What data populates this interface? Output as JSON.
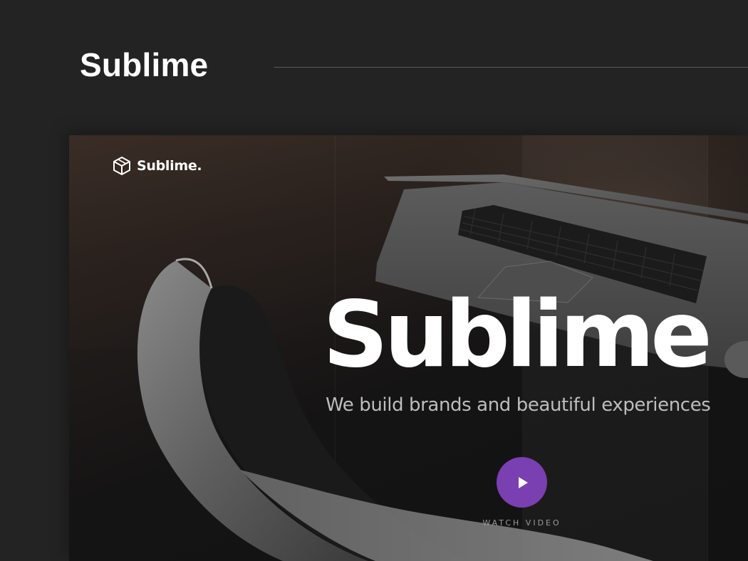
{
  "header": {
    "title": "Sublime"
  },
  "hero": {
    "brand": {
      "name": "Sublime.",
      "icon": "cube-logo-icon"
    },
    "title": "Sublime",
    "subtitle": "We build brands and beautiful experiences",
    "watch_label": "WATCH VIDEO",
    "play_icon": "play-icon"
  },
  "colors": {
    "page_background": "#232323",
    "accent_purple": "#7a3fb0",
    "text_white": "#ffffff",
    "text_muted": "#bdbdbd"
  }
}
